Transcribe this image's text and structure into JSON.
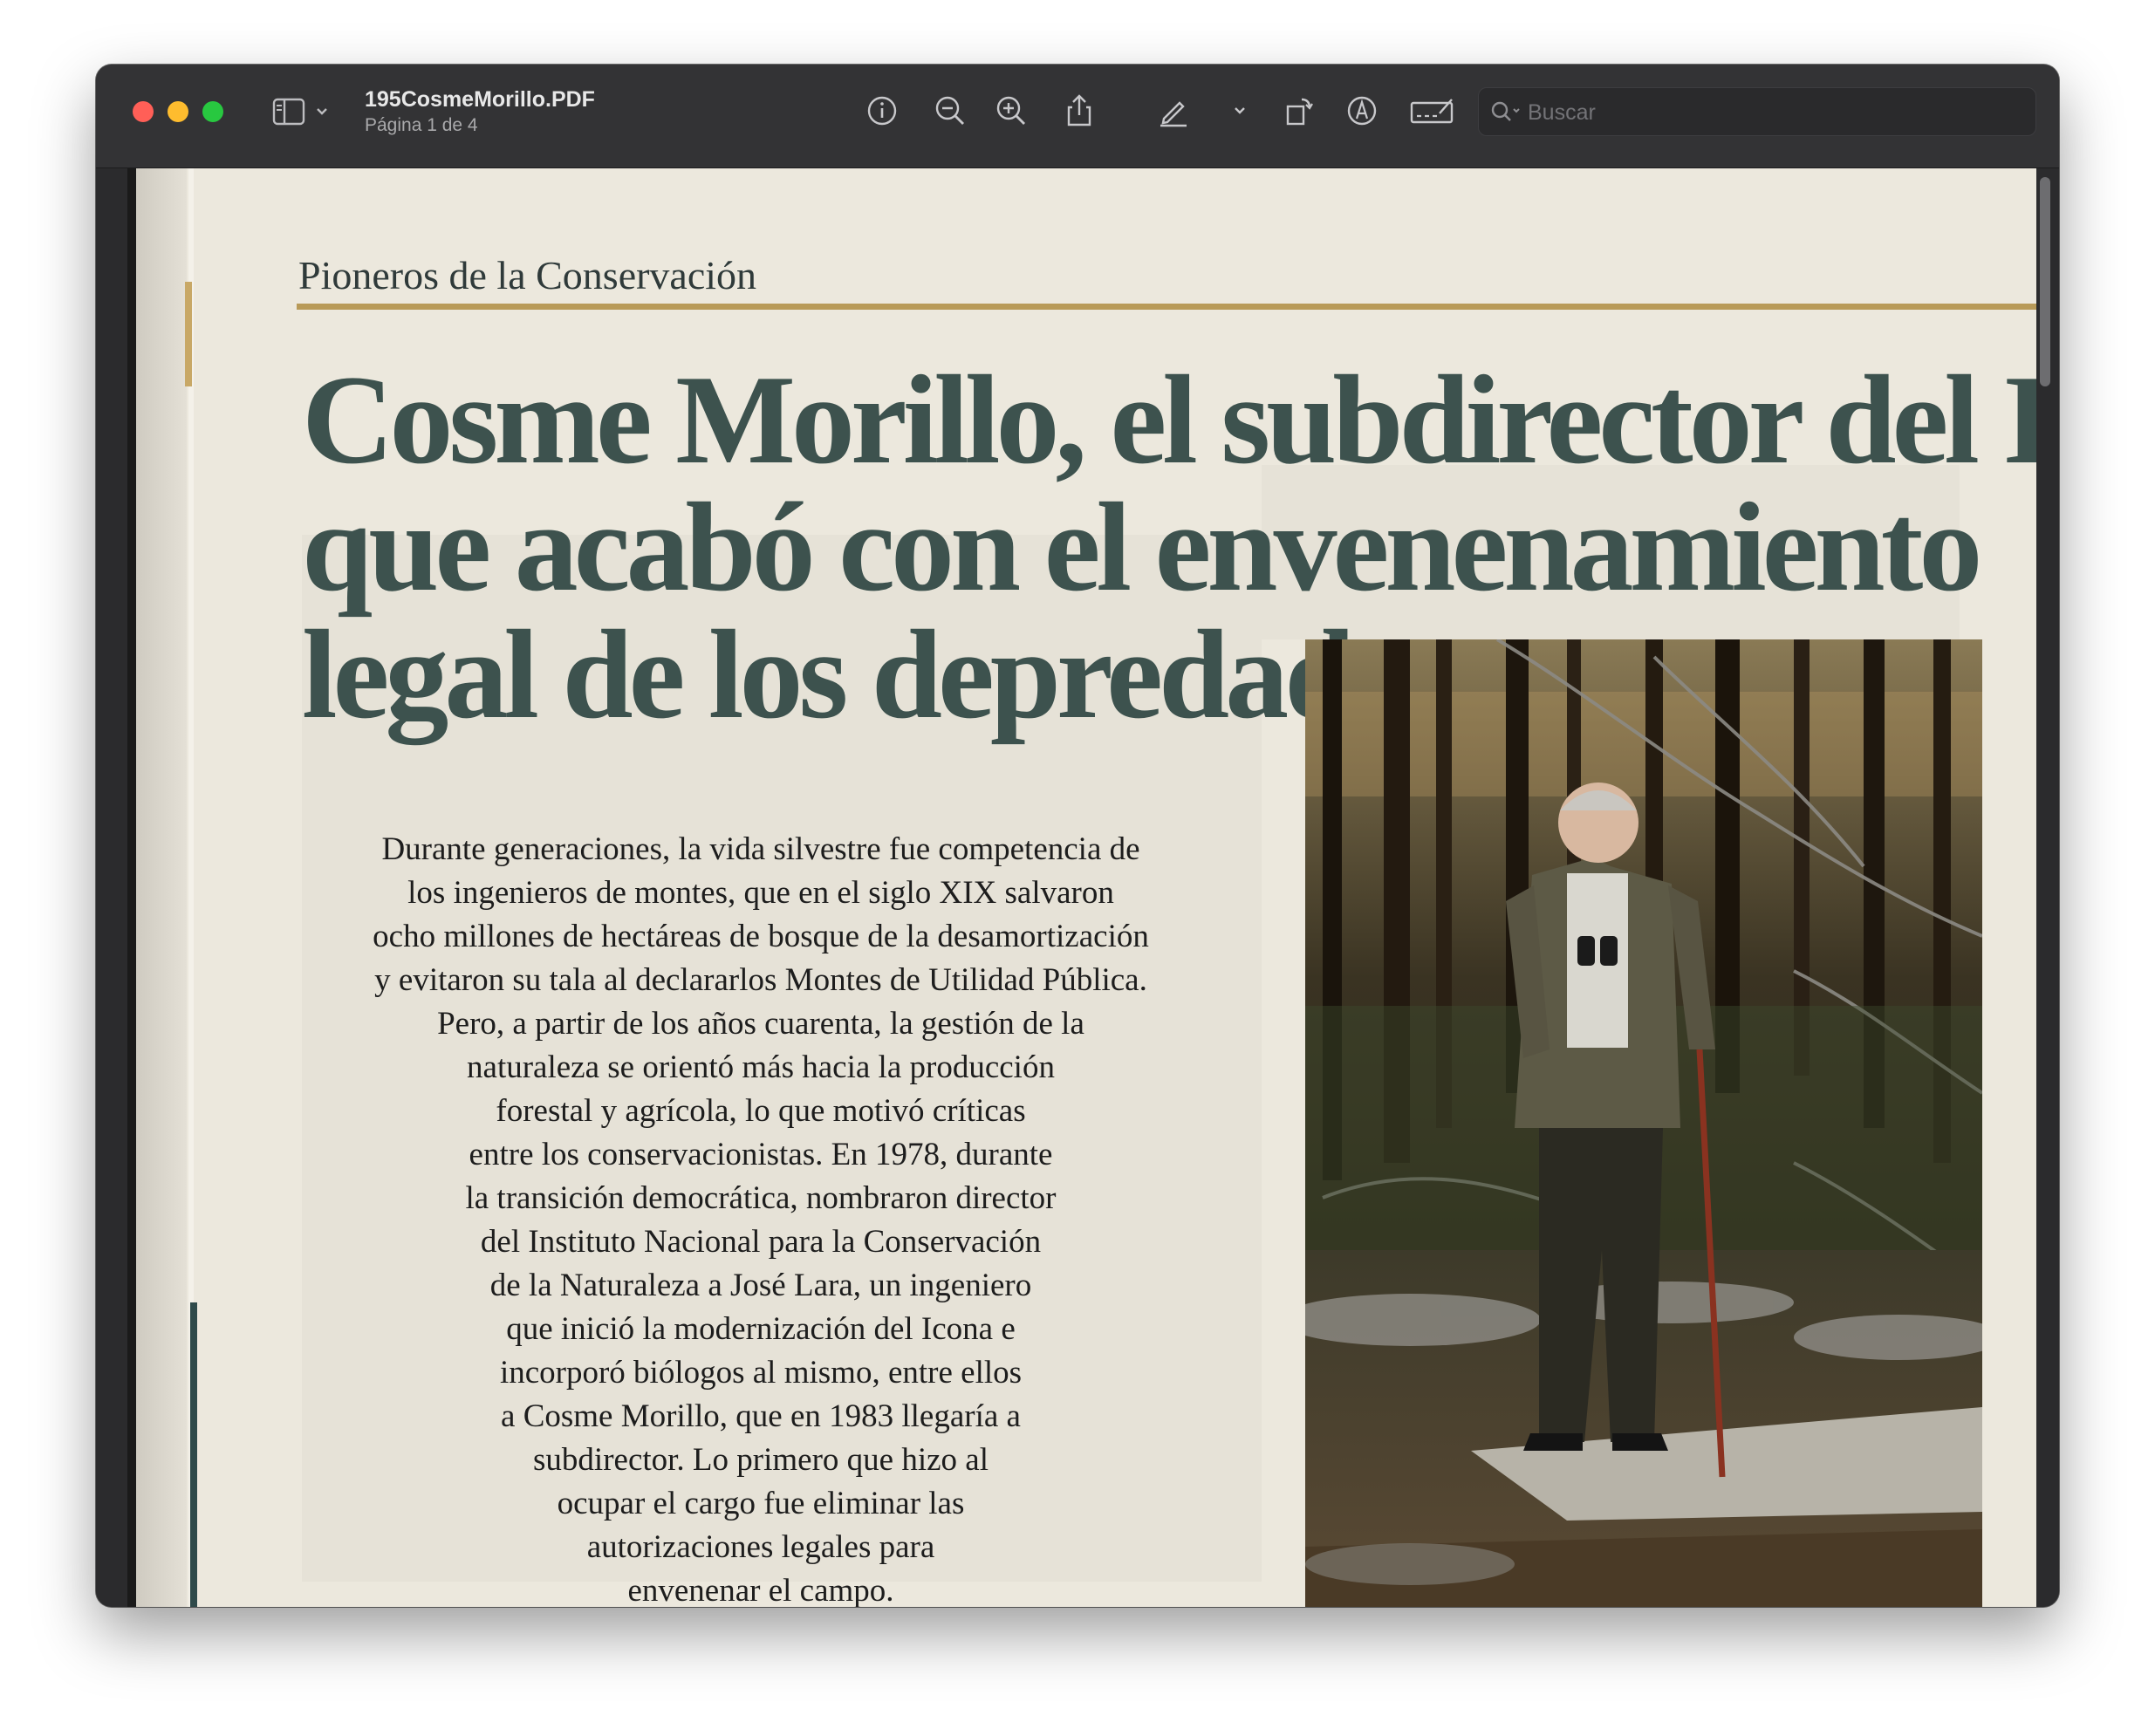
{
  "window": {
    "title": "195CosmeMorillo.PDF",
    "subtitle": "Página 1 de 4"
  },
  "toolbar": {
    "buttons": [
      "info-icon",
      "zoom-out-icon",
      "zoom-in-icon",
      "share-icon",
      "markup-pen-icon",
      "chevron-down-icon",
      "rotate-icon",
      "markup-circle-icon",
      "signature-icon"
    ],
    "search_placeholder": "Buscar"
  },
  "colors": {
    "page_paper": "#ece8dd",
    "headline": "#3d524e",
    "rule_gold": "#b89a58",
    "window_chrome": "#333335"
  },
  "article": {
    "section": "Pioneros de la Conservación",
    "headline_lines": [
      "Cosme Morillo, el subdirector del Icona",
      "que acabó con el envenenamiento",
      "legal de los depredadores"
    ],
    "lede_lines": [
      "Durante generaciones, la vida silvestre fue competencia de",
      "los ingenieros de montes, que en el siglo XIX salvaron",
      "ocho millones de hectáreas de bosque de la desamortización",
      "y evitaron su tala al declararlos Montes de Utilidad Pública.",
      "Pero, a partir de los años cuarenta, la gestión de la",
      "naturaleza se orientó más hacia la producción",
      "forestal y agrícola, lo que motivó críticas",
      "entre los conservacionistas. En 1978, durante",
      "la transición democrática, nombraron director",
      "del Instituto Nacional para la Conservación",
      "de la Naturaleza a José Lara, un ingeniero",
      "que inició la modernización del Icona e",
      "incorporó biólogos al mismo, entre ellos",
      "a Cosme Morillo, que en 1983 llegaría a",
      "subdirector. Lo primero que hizo al",
      "ocupar el cargo fue eliminar las",
      "autorizaciones legales para",
      "envenenar el campo."
    ],
    "photo": "man-in-forest-photo"
  }
}
